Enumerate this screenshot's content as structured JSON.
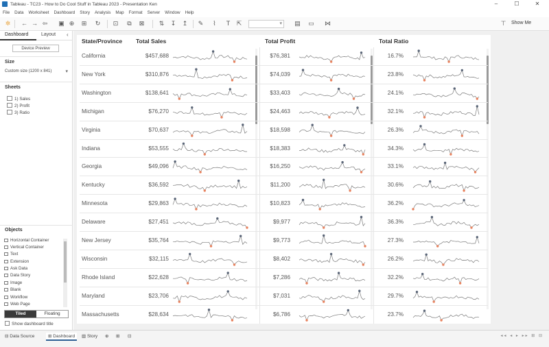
{
  "window": {
    "title": "Tableau - TC23 - How to Do Cool Stuff in Tableau 2023 - Presentation Ken",
    "minimize": "–",
    "maximize": "☐",
    "close": "✕"
  },
  "menu": [
    "File",
    "Data",
    "Worksheet",
    "Dashboard",
    "Story",
    "Analysis",
    "Map",
    "Format",
    "Server",
    "Window",
    "Help"
  ],
  "toolbar": {
    "show_me": "Show Me"
  },
  "left_panel": {
    "tab_dashboard": "Dashboard",
    "tab_layout": "Layout",
    "collapse": "‹",
    "device_preview": "Device Preview",
    "size_title": "Size",
    "size_value": "Custom size (1200 x 841)",
    "sheets_title": "Sheets",
    "sheets": [
      "1) Sales",
      "2) Profit",
      "3) Ratio"
    ],
    "objects_title": "Objects",
    "objects": [
      "Horizontal Container",
      "Vertical Container",
      "Text",
      "Extension",
      "Ask Data",
      "Data Story",
      "Image",
      "Blank",
      "Workflow",
      "Web Page"
    ],
    "tiled": "Tiled",
    "floating": "Floating",
    "show_title": "Show dashboard title"
  },
  "dashboard": {
    "headers": {
      "state": "State/Province",
      "sales": "Total Sales",
      "profit": "Total Profit",
      "ratio": "Total Ratio"
    },
    "rows": [
      {
        "state": "California",
        "sales": "$457,688",
        "profit": "$76,381",
        "ratio": "16.7%"
      },
      {
        "state": "New York",
        "sales": "$310,876",
        "profit": "$74,039",
        "ratio": "23.8%"
      },
      {
        "state": "Washington",
        "sales": "$138,641",
        "profit": "$33,403",
        "ratio": "24.1%"
      },
      {
        "state": "Michigan",
        "sales": "$76,270",
        "profit": "$24,463",
        "ratio": "32.1%"
      },
      {
        "state": "Virginia",
        "sales": "$70,637",
        "profit": "$18,598",
        "ratio": "26.3%"
      },
      {
        "state": "Indiana",
        "sales": "$53,555",
        "profit": "$18,383",
        "ratio": "34.3%"
      },
      {
        "state": "Georgia",
        "sales": "$49,096",
        "profit": "$16,250",
        "ratio": "33.1%"
      },
      {
        "state": "Kentucky",
        "sales": "$36,592",
        "profit": "$11,200",
        "ratio": "30.6%"
      },
      {
        "state": "Minnesota",
        "sales": "$29,863",
        "profit": "$10,823",
        "ratio": "36.2%"
      },
      {
        "state": "Delaware",
        "sales": "$27,451",
        "profit": "$9,977",
        "ratio": "36.3%"
      },
      {
        "state": "New Jersey",
        "sales": "$35,764",
        "profit": "$9,773",
        "ratio": "27.3%"
      },
      {
        "state": "Wisconsin",
        "sales": "$32,115",
        "profit": "$8,402",
        "ratio": "26.2%"
      },
      {
        "state": "Rhode Island",
        "sales": "$22,628",
        "profit": "$7,286",
        "ratio": "32.2%"
      },
      {
        "state": "Maryland",
        "sales": "$23,706",
        "profit": "$7,031",
        "ratio": "29.7%"
      },
      {
        "state": "Massachusetts",
        "sales": "$28,634",
        "profit": "$6,786",
        "ratio": "23.7%"
      }
    ],
    "colors": {
      "line": "#7a7a7a",
      "max_dot": "#5a6577",
      "min_dot": "#e8825e"
    }
  },
  "bottom_tabs": {
    "data_source": "Data Source",
    "dashboard": "Dashboard",
    "story": "Story"
  }
}
